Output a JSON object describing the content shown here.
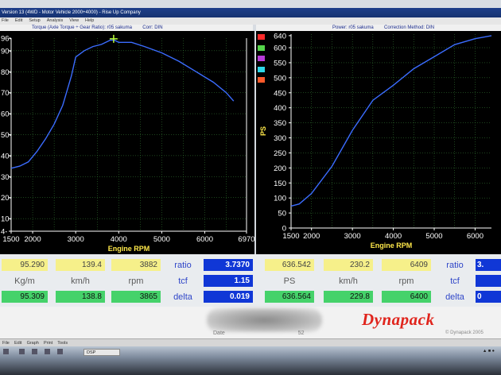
{
  "app": {
    "title": "Version 13 (4WD - Motor Vehicle 2000+4000) - Rise Up Company",
    "menu": [
      "File",
      "Edit",
      "Setup",
      "Analysis",
      "View",
      "Help"
    ]
  },
  "left_panel": {
    "header": "Torque (Axle Torque ÷ Gear Ratio): r05 sakuma",
    "corr": "Corr: DIN"
  },
  "right_panel": {
    "header": "Power: r05 sakuma",
    "corr": "Correction Method: DIN",
    "legend_colors": [
      "#ff2a2a",
      "#55d64a",
      "#b83bd8",
      "#2ed8e8",
      "#ff5a2a"
    ]
  },
  "readouts_left": {
    "current": {
      "value": "95.290",
      "speed": "139.4",
      "rpm": "3882"
    },
    "units": {
      "value": "Kg/m",
      "speed": "km/h",
      "rpm": "rpm"
    },
    "peak": {
      "value": "95.309",
      "speed": "138.8",
      "rpm": "3865"
    },
    "ratio_label": "ratio",
    "ratio_value": "3.7370",
    "tcf_label": "tcf",
    "tcf_value": "1.15",
    "delta_label": "delta",
    "delta_value": "0.019"
  },
  "readouts_right": {
    "current": {
      "value": "636.542",
      "speed": "230.2",
      "rpm": "6409"
    },
    "units": {
      "value": "PS",
      "speed": "km/h",
      "rpm": "rpm"
    },
    "peak": {
      "value": "636.564",
      "speed": "229.8",
      "rpm": "6400"
    },
    "ratio_label": "ratio",
    "ratio_value": "3.",
    "tcf_label": "tcf",
    "delta_label": "delta",
    "delta_value": "0"
  },
  "footer": {
    "date_text": "Date",
    "date_suffix": "52",
    "logo": "Dynapack",
    "logo_sub": "© Dynapack 2005"
  },
  "statusbar": {
    "text": "File    Edit    Graph    Print    Tools"
  },
  "taskbar": {
    "active_window": "DSP",
    "tray": "▲ ■ ●"
  },
  "colors": {
    "plot_bg": "#000000",
    "grid": "#3a8a3a",
    "curve": "#3b6cff",
    "axis_text": "#ffe94a"
  },
  "chart_data": [
    {
      "type": "line",
      "title": "",
      "xlabel": "Engine RPM",
      "ylabel": "",
      "xlim": [
        1500,
        6970
      ],
      "ylim": [
        4,
        96
      ],
      "x_ticks": [
        1500,
        2000,
        3000,
        4000,
        5000,
        6000,
        6970
      ],
      "y_ticks": [
        4,
        10,
        20,
        30,
        40,
        50,
        60,
        70,
        80,
        90,
        96
      ],
      "grid": true,
      "cursor": {
        "x": 3882,
        "y": 95.3
      },
      "series": [
        {
          "x": [
            1500,
            1700,
            1900,
            2100,
            2300,
            2500,
            2700,
            2900,
            3000,
            3200,
            3400,
            3600,
            3700,
            3800,
            3900,
            4000,
            4300,
            4600,
            5000,
            5400,
            5800,
            6200,
            6500,
            6670
          ],
          "y": [
            34,
            35,
            37,
            42,
            48,
            55,
            64,
            78,
            87,
            90,
            92,
            93,
            94,
            95,
            95,
            94,
            94,
            92,
            89,
            85,
            80,
            75,
            70,
            66
          ]
        }
      ]
    },
    {
      "type": "line",
      "title": "",
      "xlabel": "Engine RPM",
      "ylabel": "PS",
      "xlim": [
        1500,
        6400
      ],
      "ylim": [
        0,
        645
      ],
      "x_ticks": [
        1500,
        2000,
        3000,
        4000,
        5000,
        6000
      ],
      "y_ticks": [
        0,
        50,
        100,
        150,
        200,
        250,
        300,
        350,
        400,
        450,
        500,
        550,
        600,
        640
      ],
      "grid": true,
      "series": [
        {
          "x": [
            1500,
            1700,
            2000,
            2500,
            3000,
            3500,
            4000,
            4500,
            5000,
            5500,
            6000,
            6400
          ],
          "y": [
            73,
            80,
            115,
            205,
            325,
            425,
            475,
            530,
            570,
            610,
            630,
            640
          ]
        }
      ]
    }
  ]
}
